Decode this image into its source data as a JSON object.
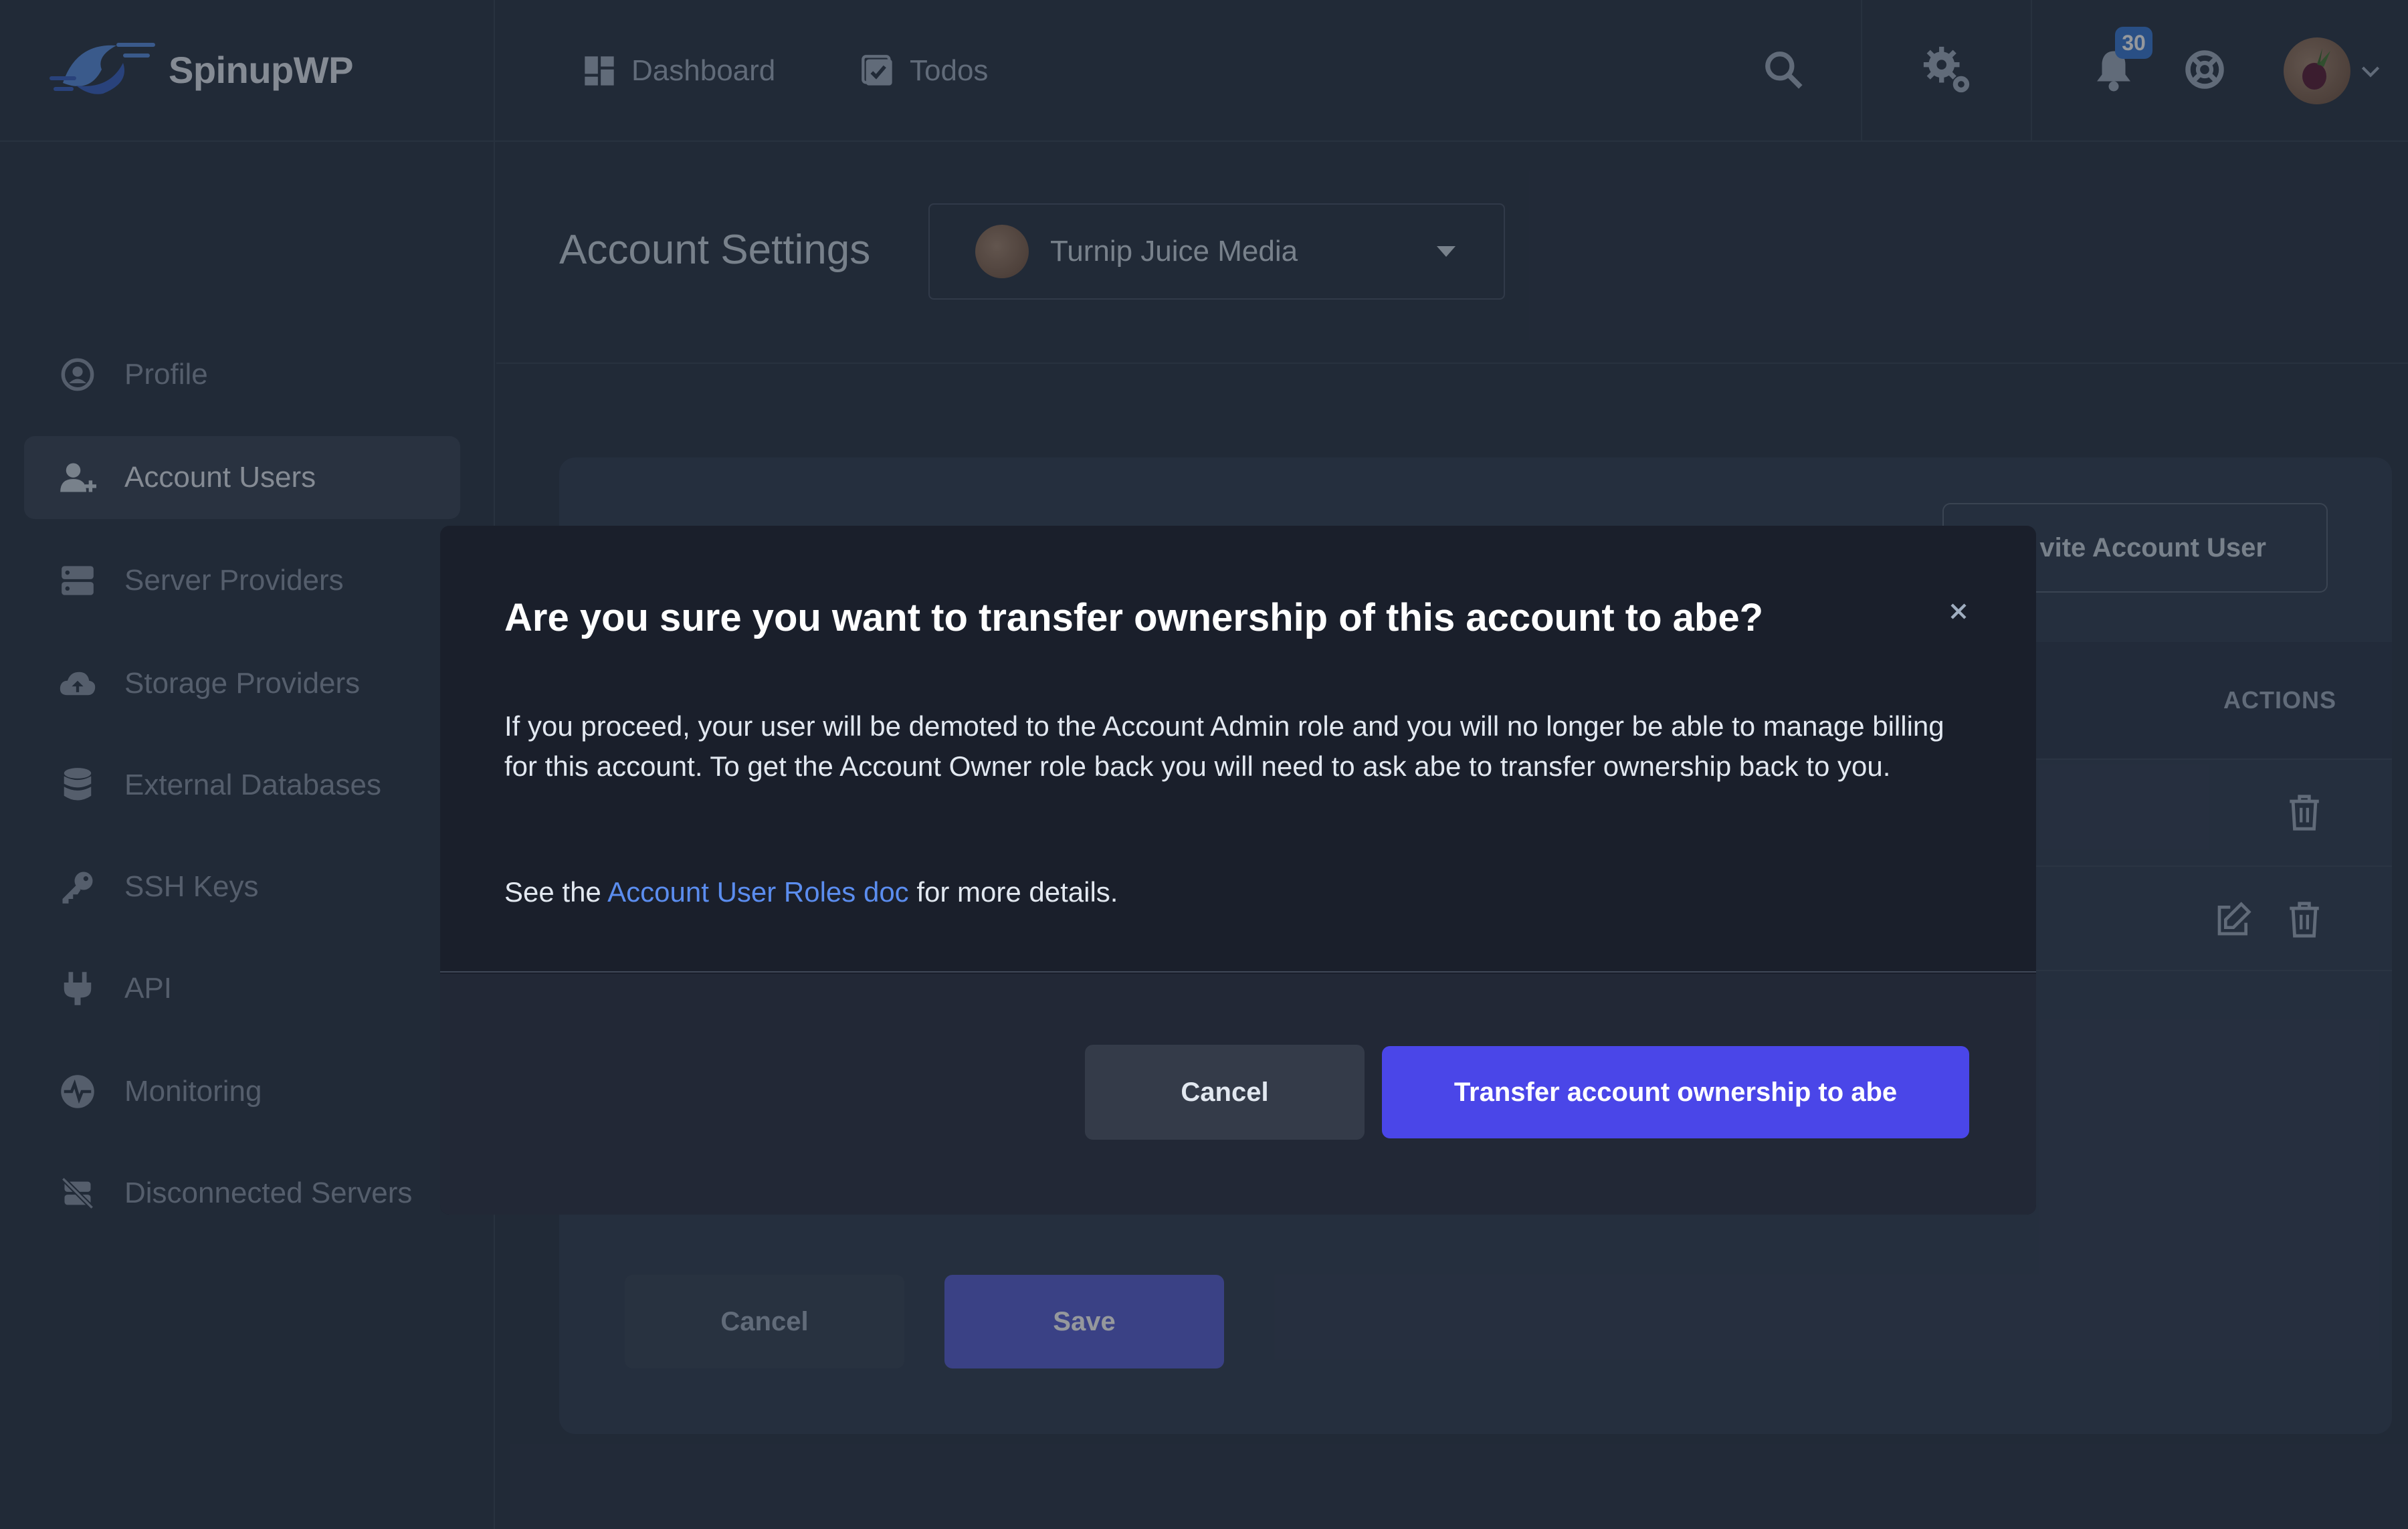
{
  "app": {
    "name": "SpinupWP"
  },
  "topnav": {
    "links": [
      {
        "label": "Dashboard",
        "icon": "dashboard-icon"
      },
      {
        "label": "Todos",
        "icon": "todos-icon"
      }
    ],
    "notifications_count": "30",
    "icons": [
      "search-icon",
      "gear-icon",
      "bell-icon",
      "lifebuoy-icon",
      "avatar",
      "chevron-down-icon"
    ]
  },
  "sidebar": {
    "items": [
      {
        "label": "Profile",
        "icon": "user-circle-icon",
        "active": false
      },
      {
        "label": "Account Users",
        "icon": "user-plus-icon",
        "active": true
      },
      {
        "label": "Server Providers",
        "icon": "server-icon",
        "active": false
      },
      {
        "label": "Storage Providers",
        "icon": "cloud-upload-icon",
        "active": false
      },
      {
        "label": "External Databases",
        "icon": "database-icon",
        "active": false
      },
      {
        "label": "SSH Keys",
        "icon": "key-icon",
        "active": false
      },
      {
        "label": "API",
        "icon": "plug-icon",
        "active": false
      },
      {
        "label": "Monitoring",
        "icon": "heartbeat-icon",
        "active": false
      },
      {
        "label": "Disconnected Servers",
        "icon": "disconnected-server-icon",
        "active": false
      }
    ]
  },
  "main": {
    "title": "Account Settings",
    "account_select": {
      "value": "Turnip Juice Media"
    },
    "invite_button": "vite Account User",
    "table": {
      "actions_header": "ACTIONS"
    },
    "cancel_label": "Cancel",
    "save_label": "Save"
  },
  "modal": {
    "title": "Are you sure you want to transfer ownership of this account to abe?",
    "body": "If you proceed, your user will be demoted to the Account Admin role and you will no longer be able to manage billing for this account. To get the Account Owner role back you will need to ask abe to transfer ownership back to you.",
    "details_prefix": "See the ",
    "details_link": "Account User Roles doc",
    "details_suffix": " for more details.",
    "cancel_label": "Cancel",
    "confirm_label": "Transfer account ownership to abe"
  },
  "colors": {
    "background": "#2d3748",
    "modal": "#1a1f2b",
    "primary_button": "#4a46e8",
    "link": "#5b8def",
    "badge": "#3b7bd6"
  }
}
